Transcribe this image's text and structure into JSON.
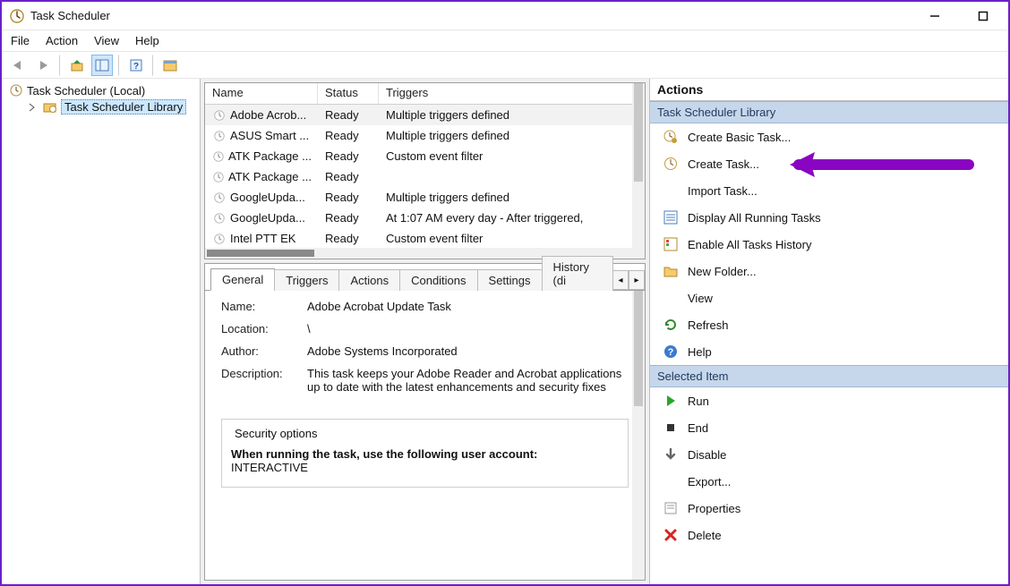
{
  "window": {
    "title": "Task Scheduler"
  },
  "menubar": [
    "File",
    "Action",
    "View",
    "Help"
  ],
  "nav": {
    "root": "Task Scheduler (Local)",
    "child": "Task Scheduler Library"
  },
  "listColumns": {
    "name": "Name",
    "status": "Status",
    "triggers": "Triggers"
  },
  "tasks": [
    {
      "name": "Adobe Acrob...",
      "status": "Ready",
      "triggers": "Multiple triggers defined"
    },
    {
      "name": "ASUS Smart ...",
      "status": "Ready",
      "triggers": "Multiple triggers defined"
    },
    {
      "name": "ATK Package ...",
      "status": "Ready",
      "triggers": "Custom event filter"
    },
    {
      "name": "ATK Package ...",
      "status": "Ready",
      "triggers": ""
    },
    {
      "name": "GoogleUpda...",
      "status": "Ready",
      "triggers": "Multiple triggers defined"
    },
    {
      "name": "GoogleUpda...",
      "status": "Ready",
      "triggers": "At 1:07 AM every day - After triggered,"
    },
    {
      "name": "Intel PTT EK",
      "status": "Ready",
      "triggers": "Custom event filter"
    }
  ],
  "tabs": [
    "General",
    "Triggers",
    "Actions",
    "Conditions",
    "Settings",
    "History (di"
  ],
  "general": {
    "nameLabel": "Name:",
    "nameValue": "Adobe Acrobat Update Task",
    "locationLabel": "Location:",
    "locationValue": "\\",
    "authorLabel": "Author:",
    "authorValue": "Adobe Systems Incorporated",
    "descriptionLabel": "Description:",
    "descriptionValue": "This task keeps your Adobe Reader and Acrobat applications up to date with the latest enhancements and security fixes",
    "securityLegend": "Security options",
    "securityLine1": "When running the task, use the following user account:",
    "securityLine2": "INTERACTIVE"
  },
  "actionsPane": {
    "title": "Actions",
    "group1": "Task Scheduler Library",
    "group1Items": [
      {
        "id": "create-basic",
        "label": "Create Basic Task...",
        "icon": "clock-gear"
      },
      {
        "id": "create-task",
        "label": "Create Task...",
        "icon": "clock-new"
      },
      {
        "id": "import-task",
        "label": "Import Task...",
        "icon": "blank"
      },
      {
        "id": "display-all",
        "label": "Display All Running Tasks",
        "icon": "list"
      },
      {
        "id": "enable-hist",
        "label": "Enable All Tasks History",
        "icon": "history"
      },
      {
        "id": "new-folder",
        "label": "New Folder...",
        "icon": "folder"
      },
      {
        "id": "view",
        "label": "View",
        "icon": "blank"
      },
      {
        "id": "refresh",
        "label": "Refresh",
        "icon": "refresh"
      },
      {
        "id": "help",
        "label": "Help",
        "icon": "help"
      }
    ],
    "group2": "Selected Item",
    "group2Items": [
      {
        "id": "run",
        "label": "Run",
        "icon": "play"
      },
      {
        "id": "end",
        "label": "End",
        "icon": "stop"
      },
      {
        "id": "disable",
        "label": "Disable",
        "icon": "down"
      },
      {
        "id": "export",
        "label": "Export...",
        "icon": "blank"
      },
      {
        "id": "properties",
        "label": "Properties",
        "icon": "props"
      },
      {
        "id": "delete",
        "label": "Delete",
        "icon": "delete"
      }
    ]
  }
}
